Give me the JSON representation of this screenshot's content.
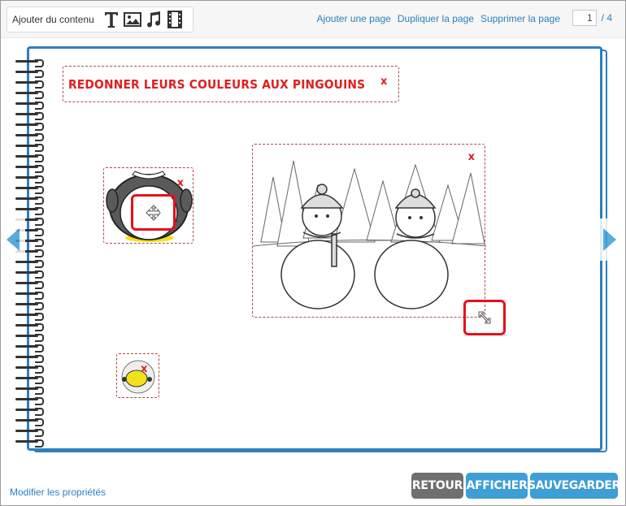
{
  "toolbar": {
    "add_content_label": "Ajouter du contenu",
    "tools": [
      {
        "icon": "text-icon",
        "glyph": "T"
      },
      {
        "icon": "image-icon"
      },
      {
        "icon": "music-icon",
        "glyph": "♫"
      },
      {
        "icon": "video-icon"
      }
    ],
    "add_page": "Ajouter une page",
    "duplicate_page": "Dupliquer la page",
    "delete_page": "Supprimer la page",
    "current_page": "1",
    "total_pages": "/ 4"
  },
  "canvas": {
    "title_text": "REDONNER LEURS COULEURS AUX PINGOUINS",
    "delete_glyph": "x",
    "accent_color": "#e0201f",
    "notebook_color": "#2d7fbf"
  },
  "footer": {
    "modify_properties": "Modifier les propriétés",
    "retour": "RETOUR",
    "afficher": "AFFICHER",
    "sauvegarder": "SAUVEGARDER"
  }
}
